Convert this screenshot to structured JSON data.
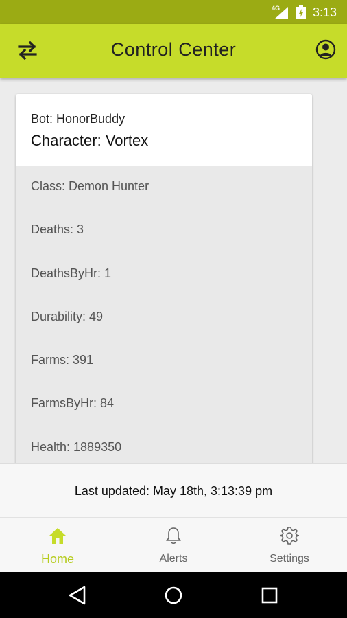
{
  "status_bar": {
    "network": "4G",
    "time": "3:13",
    "icons": [
      "signal-icon",
      "battery-icon"
    ]
  },
  "app_bar": {
    "title": "Control Center",
    "left_icon": "swap-icon",
    "right_icon": "account-icon"
  },
  "card": {
    "bot": "Bot: HonorBuddy",
    "character": "Character: Vortex",
    "stats": [
      "Class: Demon Hunter",
      "Deaths: 3",
      "DeathsByHr: 1",
      "Durability: 49",
      "Farms: 391",
      "FarmsByHr: 84",
      "Health: 1889350"
    ]
  },
  "last_updated": "Last updated: May 18th, 3:13:39 pm",
  "bottom_nav": {
    "items": [
      {
        "label": "Home",
        "icon": "home-icon",
        "active": true
      },
      {
        "label": "Alerts",
        "icon": "bell-icon",
        "active": false
      },
      {
        "label": "Settings",
        "icon": "gear-icon",
        "active": false
      }
    ]
  },
  "system_nav": [
    "back-icon",
    "home-circle-icon",
    "recents-icon"
  ],
  "colors": {
    "accent": "#c6dc2a",
    "status_bar": "#9bab14",
    "active_tab": "#b6cc1e"
  }
}
